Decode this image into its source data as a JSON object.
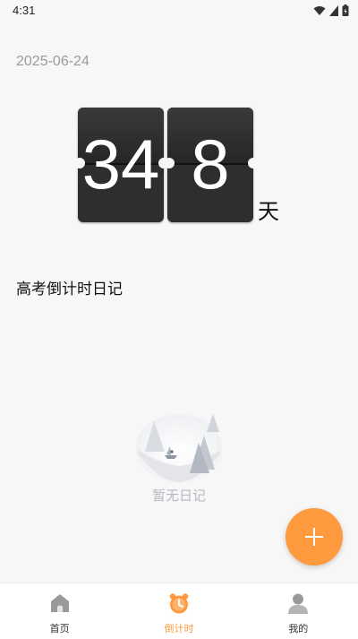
{
  "status_bar": {
    "time": "4:31",
    "icons": [
      "wifi-icon",
      "signal-icon",
      "battery-icon"
    ]
  },
  "countdown": {
    "date": "2025-06-24",
    "digits": [
      "34",
      "8"
    ],
    "unit": "天"
  },
  "diary": {
    "title": "高考倒计时日记",
    "empty_text": "暂无日记"
  },
  "fab": {
    "icon": "plus-icon"
  },
  "tabs": [
    {
      "label": "首页",
      "icon": "home-icon",
      "active": false
    },
    {
      "label": "倒计时",
      "icon": "alarm-clock-icon",
      "active": true
    },
    {
      "label": "我的",
      "icon": "person-icon",
      "active": false
    }
  ],
  "colors": {
    "accent": "#ff9a3f",
    "background": "#f7f7f7",
    "flip_card": "#2e2e2e",
    "muted_text": "#9a9a9a"
  }
}
